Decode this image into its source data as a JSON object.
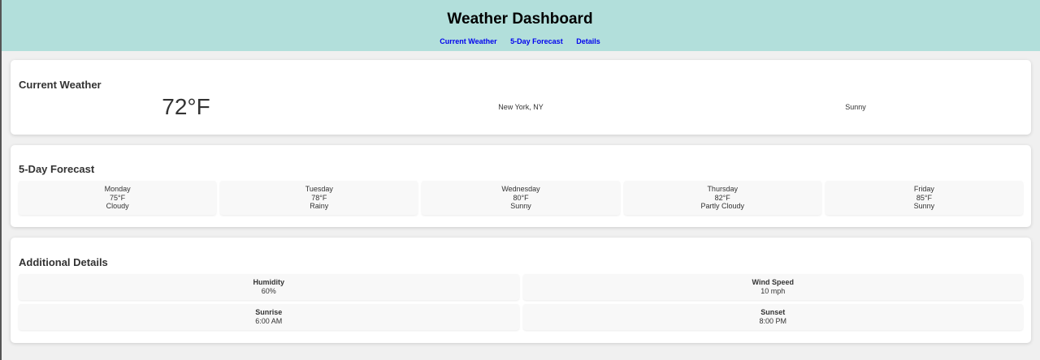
{
  "header": {
    "title": "Weather Dashboard",
    "nav": [
      "Current Weather",
      "5-Day Forecast",
      "Details"
    ]
  },
  "current": {
    "heading": "Current Weather",
    "temperature": "72°F",
    "location": "New York, NY",
    "condition": "Sunny"
  },
  "forecast": {
    "heading": "5-Day Forecast",
    "days": [
      {
        "day": "Monday",
        "temp": "75°F",
        "condition": "Cloudy"
      },
      {
        "day": "Tuesday",
        "temp": "78°F",
        "condition": "Rainy"
      },
      {
        "day": "Wednesday",
        "temp": "80°F",
        "condition": "Sunny"
      },
      {
        "day": "Thursday",
        "temp": "82°F",
        "condition": "Partly Cloudy"
      },
      {
        "day": "Friday",
        "temp": "85°F",
        "condition": "Sunny"
      }
    ]
  },
  "details": {
    "heading": "Additional Details",
    "items": [
      {
        "label": "Humidity",
        "value": "60%"
      },
      {
        "label": "Wind Speed",
        "value": "10 mph"
      },
      {
        "label": "Sunrise",
        "value": "6:00 AM"
      },
      {
        "label": "Sunset",
        "value": "8:00 PM"
      }
    ]
  },
  "colors": {
    "header_bg": "#b2dfdb",
    "nav_link": "#0000ee",
    "page_bg": "#f0f0f0"
  }
}
